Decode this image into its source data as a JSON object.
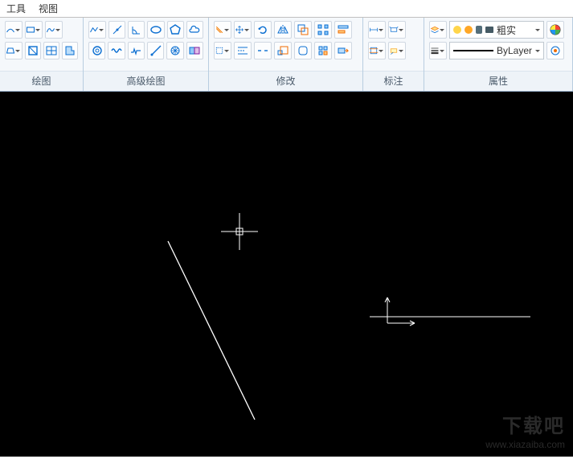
{
  "menu": {
    "tools": "工具",
    "view": "视图"
  },
  "panels": {
    "draw": "绘图",
    "advdraw": "高级绘图",
    "modify": "修改",
    "annotate": "标注",
    "properties": "属性"
  },
  "props": {
    "layer_state": "粗实",
    "linetype": "ByLayer"
  },
  "watermark": {
    "site": "下载吧",
    "url": "www.xiazaiba.com"
  }
}
